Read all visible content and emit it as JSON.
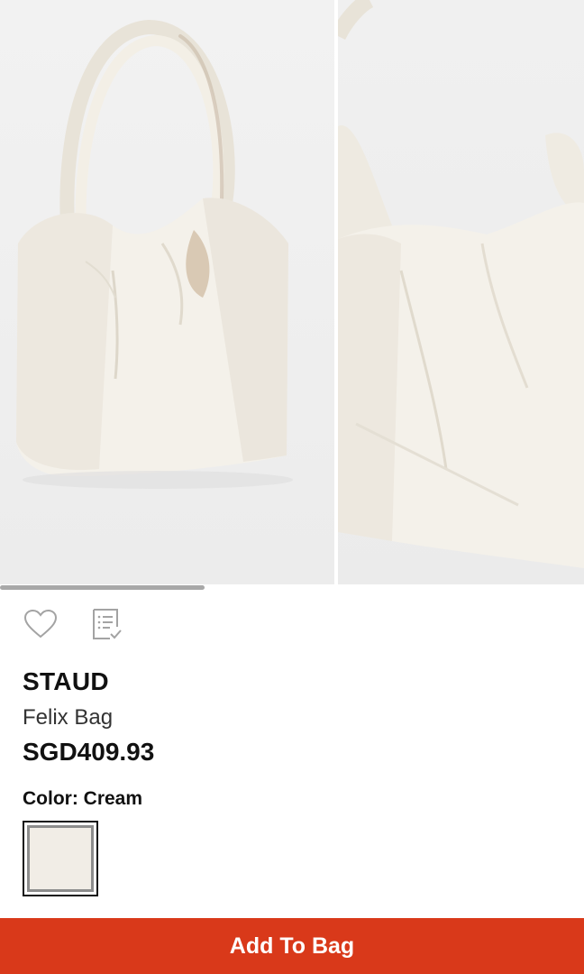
{
  "gallery": {
    "images": [
      {
        "alt": "Felix Bag front view"
      },
      {
        "alt": "Felix Bag detail view"
      }
    ],
    "scroll_progress": 0.35
  },
  "actions": {
    "wishlist_icon": "heart-outline-icon",
    "list_icon": "checklist-icon"
  },
  "product": {
    "brand": "STAUD",
    "name": "Felix Bag",
    "price": "SGD409.93"
  },
  "color": {
    "label": "Color: Cream",
    "swatches": [
      {
        "name": "Cream",
        "hex": "#f1ede6",
        "selected": true
      }
    ]
  },
  "cta": {
    "add_to_bag": "Add To Bag",
    "color": "#d9391a"
  }
}
